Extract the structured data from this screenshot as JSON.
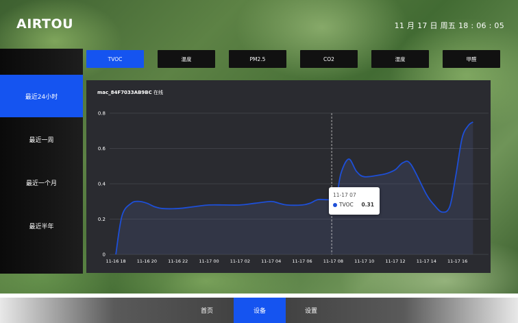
{
  "header": {
    "logo_text": "AIRTOU",
    "datetime": "11 月 17 日 周五 18 : 06 : 05"
  },
  "sidebar": {
    "items": [
      {
        "label": "最近24小时",
        "active": true
      },
      {
        "label": "最近一周",
        "active": false
      },
      {
        "label": "最近一个月",
        "active": false
      },
      {
        "label": "最近半年",
        "active": false
      }
    ]
  },
  "tabs": [
    {
      "label": "TVOC",
      "active": true
    },
    {
      "label": "温度",
      "active": false
    },
    {
      "label": "PM2.5",
      "active": false
    },
    {
      "label": "CO2",
      "active": false
    },
    {
      "label": "湿度",
      "active": false
    },
    {
      "label": "甲醛",
      "active": false
    }
  ],
  "device": {
    "mac": "mac_84F7033AB9BC",
    "status": "在线"
  },
  "tooltip": {
    "time": "11-17 07",
    "series": "TVOC",
    "value": "0.31"
  },
  "footer": {
    "items": [
      {
        "label": "首页",
        "active": false
      },
      {
        "label": "设备",
        "active": true
      },
      {
        "label": "设置",
        "active": false
      }
    ]
  },
  "colors": {
    "accent": "#1554f0",
    "line": "#1d4fd8",
    "panel": "#2a2b30"
  },
  "chart_data": {
    "type": "line",
    "x_tick_labels": [
      "11-16 18",
      "11-16 20",
      "11-16 22",
      "11-17 00",
      "11-17 02",
      "11-17 04",
      "11-17 06",
      "11-17 08",
      "11-17 10",
      "11-17 12",
      "11-17 14",
      "11-17 16"
    ],
    "ylim": [
      0,
      0.8
    ],
    "y_ticks": [
      0,
      0.2,
      0.4,
      0.6,
      0.8
    ],
    "grid": true,
    "series": [
      {
        "name": "TVOC",
        "x": [
          18.0,
          18.4,
          19.0,
          19.5,
          20.0,
          20.5,
          21.0,
          22.0,
          23.0,
          24.0,
          25.0,
          26.0,
          27.0,
          28.0,
          28.5,
          29.0,
          30.0,
          30.5,
          31.0,
          31.5,
          31.9,
          32.2,
          32.5,
          33.0,
          33.5,
          34.0,
          35.0,
          35.5,
          36.0,
          36.5,
          37.0,
          38.0,
          38.5,
          39.0,
          39.5,
          39.9,
          40.3,
          40.7,
          41.0
        ],
        "y": [
          0,
          0.22,
          0.29,
          0.3,
          0.29,
          0.27,
          0.26,
          0.26,
          0.27,
          0.28,
          0.28,
          0.28,
          0.29,
          0.3,
          0.29,
          0.28,
          0.28,
          0.29,
          0.31,
          0.31,
          0.31,
          0.32,
          0.46,
          0.54,
          0.47,
          0.44,
          0.45,
          0.46,
          0.48,
          0.52,
          0.51,
          0.34,
          0.28,
          0.24,
          0.27,
          0.45,
          0.66,
          0.73,
          0.75
        ]
      }
    ],
    "highlight": {
      "x": 31.9,
      "y": 0.31
    }
  }
}
